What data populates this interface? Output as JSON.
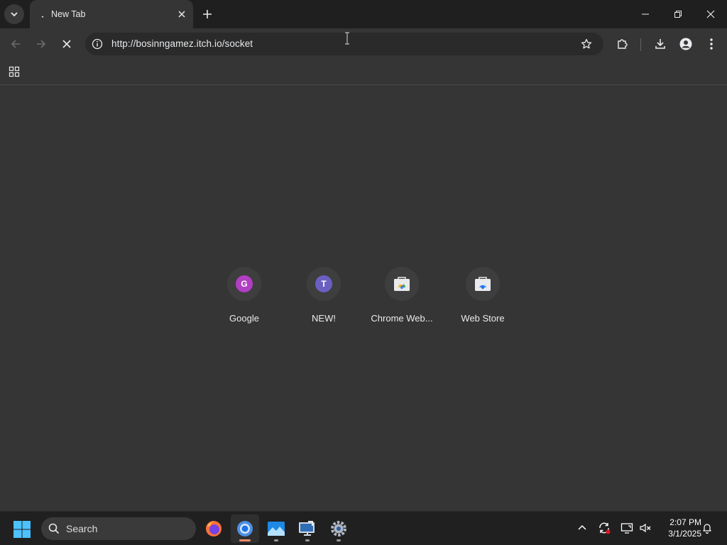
{
  "browser": {
    "tab": {
      "title": "New Tab"
    },
    "omnibox": {
      "url": "http://bosinngamez.itch.io/socket"
    }
  },
  "shortcuts": [
    {
      "label": "Google",
      "letter": "G",
      "color": "#b23ec4"
    },
    {
      "label": "NEW!",
      "letter": "T",
      "color": "#6b5fc2"
    },
    {
      "label": "Chrome Web...",
      "icon": "web-store-icon"
    },
    {
      "label": "Web Store",
      "icon": "web-store-icon"
    }
  ],
  "taskbar": {
    "search_label": "Search",
    "apps": [
      "firefox-icon",
      "chrome-icon",
      "photos-icon",
      "remote-desktop-icon",
      "settings-icon"
    ],
    "clock": {
      "time": "2:07 PM",
      "date": "3/1/2025"
    }
  }
}
